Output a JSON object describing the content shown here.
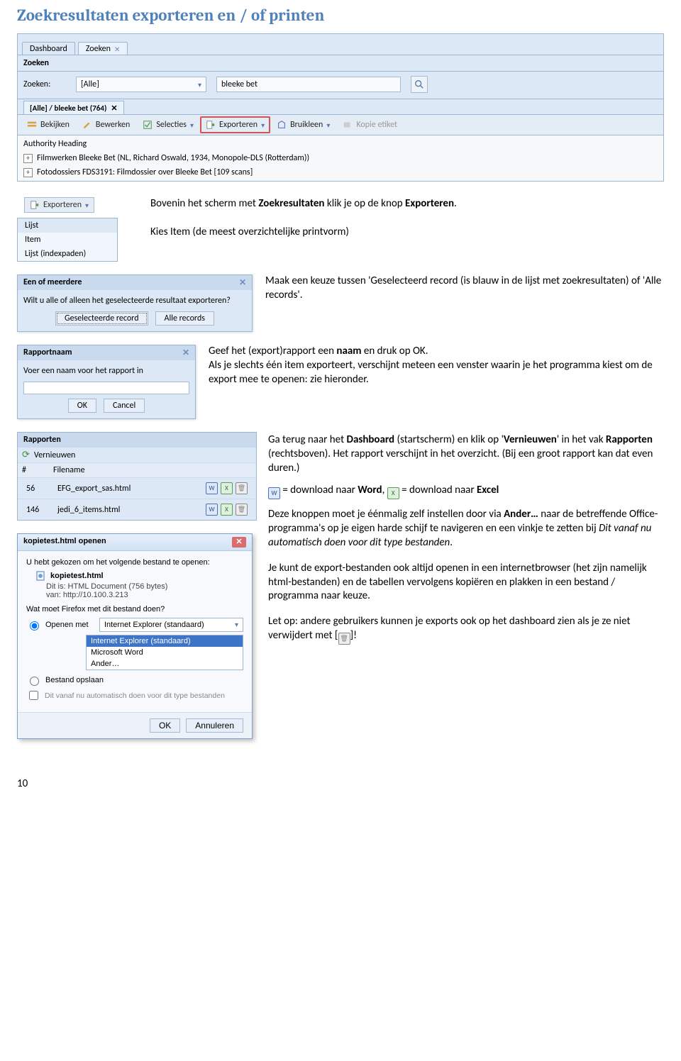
{
  "title": "Zoekresultaten exporteren en / of printen",
  "pageNumber": "10",
  "screenshot": {
    "tab1": "Dashboard",
    "tab2": "Zoeken",
    "panelLabel": "Zoeken",
    "searchLabel": "Zoeken:",
    "selectValue": "[Alle]",
    "inputValue": "bleeke bet",
    "resultTab": "[Alle] / bleeke bet (764)",
    "toolbar": {
      "bekijken": "Bekijken",
      "bewerken": "Bewerken",
      "selecties": "Selecties",
      "exporteren": "Exporteren",
      "bruikleen": "Bruikleen",
      "kopie": "Kopie etiket"
    },
    "rows": {
      "r0": "Authority Heading",
      "r1": "Filmwerken Bleeke Bet (NL, Richard Oswald, 1934, Monopole-DLS (Rotterdam))",
      "r2": "Fotodossiers FDS3191: Filmdossier over Bleeke Bet [109 scans]"
    }
  },
  "section1": {
    "btnLabel": "Exporteren",
    "menu": {
      "m1": "Lijst",
      "m2": "Item",
      "m3": "Lijst (indexpaden)"
    },
    "p1a": "Bovenin het scherm met ",
    "p1b": "Zoekresultaten",
    "p1c": " klik je op de knop ",
    "p1d": "Exporteren",
    "p1e": ".",
    "p2": "Kies Item (de meest overzichtelijke printvorm)"
  },
  "section2": {
    "dlg": {
      "title": "Een of meerdere",
      "question": "Wilt u alle of alleen het geselecteerde resultaat exporteren?",
      "btn1": "Geselecteerde record",
      "btn2": "Alle records"
    },
    "text": "Maak een keuze tussen 'Geselecteerd record (is blauw in de lijst met zoekresultaten) of 'Alle records'."
  },
  "section3": {
    "dlg": {
      "title": "Rapportnaam",
      "prompt": "Voer een naam voor het rapport in",
      "ok": "OK",
      "cancel": "Cancel"
    },
    "p1a": "Geef het (export)rapport een ",
    "p1b": "naam",
    "p1c": " en druk op OK.",
    "p2": "Als je slechts één item exporteert, verschijnt meteen een venster waarin je het programma kiest om de export mee te openen: zie hieronder."
  },
  "section4": {
    "rapporten": {
      "title": "Rapporten",
      "vernieuwen": "Vernieuwen",
      "hNum": "#",
      "hFile": "Filename",
      "r1num": "56",
      "r1file": "EFG_export_sas.html",
      "r2num": "146",
      "r2file": "jedi_6_items.html"
    },
    "p1a": "Ga terug naar het ",
    "p1b": "Dashboard",
    "p1c": " (startscherm) en klik op '",
    "p1d": "Vernieuwen",
    "p1e": "' in het vak ",
    "p1f": "Rapporten",
    "p1g": " (rechtsboven). Het rapport verschijnt in het overzicht. (Bij een groot rapport kan dat even duren.)",
    "dlLine_a": " = download naar ",
    "dlLine_b": "Word",
    "dlLine_c": ", ",
    "dlLine_d": " = download naar ",
    "dlLine_e": "Excel",
    "p3a": "Deze knoppen moet je éénmalig zelf instellen door via ",
    "p3b": "Ander…",
    "p3c": " naar de betreffende Office-programma's op je eigen harde schijf te navigeren en een vinkje te zetten bij ",
    "p3d": "Dit vanaf nu automatisch doen voor dit type bestanden",
    "p3e": ".",
    "p4": "Je kunt de export-bestanden ook altijd openen in een internetbrowser (het zijn namelijk html-bestanden) en de tabellen vervolgens kopiëren en plakken in een bestand / programma naar keuze.",
    "p5a": "Let op: andere gebruikers kunnen je exports ook op het dashboard zien als je ze niet verwijdert met [",
    "p5b": "]!"
  },
  "winDialog": {
    "title": "kopietest.html openen",
    "l1": "U hebt gekozen om het volgende bestand te openen:",
    "filename": "kopietest.html",
    "type": "Dit is:  HTML Document (756 bytes)",
    "from": "van:  http://10.100.3.213",
    "l4": "Wat moet Firefox met dit bestand doen?",
    "openWith": "Openen met",
    "selected": "Internet Explorer (standaard)",
    "opslaan": "Bestand opslaan",
    "check": "Dit vanaf nu automatisch doen voor dit type bestanden",
    "dd1": "Internet Explorer (standaard)",
    "dd2": "Microsoft Word",
    "dd3": "Ander…",
    "ok": "OK",
    "cancel": "Annuleren"
  }
}
